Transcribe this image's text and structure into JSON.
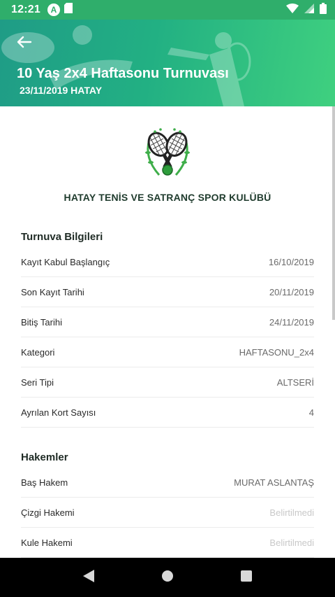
{
  "status_bar": {
    "time": "12:21",
    "icons": [
      "a-icon",
      "sd-card-icon",
      "wifi-icon",
      "signal-icon",
      "battery-icon"
    ],
    "circle_letter": "A"
  },
  "header": {
    "title": "10 Yaş 2x4 Haftasonu Turnuvası",
    "subtitle": "23/11/2019 HATAY",
    "colors": {
      "start": "#1f9c86",
      "end": "#3fd07f"
    }
  },
  "club": {
    "name": "HATAY TENİS VE SATRANÇ SPOR KULÜBÜ"
  },
  "tournament_info": {
    "title": "Turnuva Bilgileri",
    "rows": [
      {
        "label": "Kayıt Kabul Başlangıç",
        "value": "16/10/2019"
      },
      {
        "label": "Son Kayıt Tarihi",
        "value": "20/11/2019"
      },
      {
        "label": "Bitiş Tarihi",
        "value": "24/11/2019"
      },
      {
        "label": "Kategori",
        "value": "HAFTASONU_2x4"
      },
      {
        "label": "Seri Tipi",
        "value": "ALTSERİ"
      },
      {
        "label": "Ayrılan Kort Sayısı",
        "value": "4"
      }
    ]
  },
  "referees": {
    "title": "Hakemler",
    "rows": [
      {
        "label": "Baş Hakem",
        "value": "MURAT ASLANTAŞ"
      },
      {
        "label": "Çizgi Hakemi",
        "value": "Belirtilmedi"
      },
      {
        "label": "Kule Hakemi",
        "value": "Belirtilmedi"
      }
    ]
  }
}
